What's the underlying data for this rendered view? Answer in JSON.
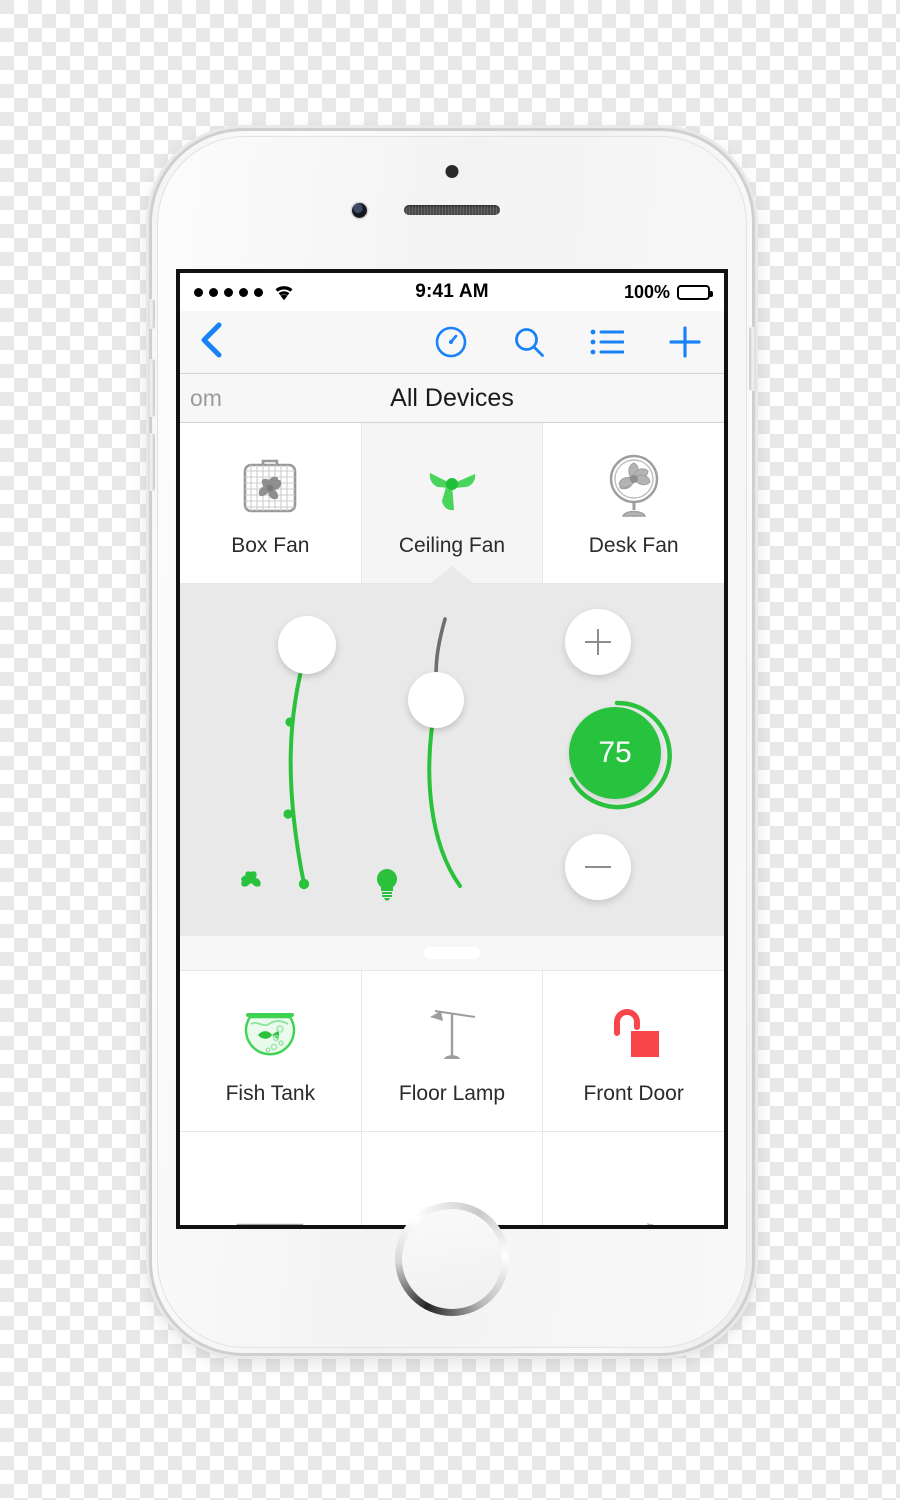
{
  "device": {
    "type": "smartphone",
    "color": "silver-white"
  },
  "statusbar": {
    "signal_dots": 5,
    "wifi_icon": "wifi-icon",
    "time": "9:41 AM",
    "battery_percent": "100%",
    "battery_level": 100
  },
  "navbar": {
    "back_icon": "chevron-left-icon",
    "accent_color": "#1a82f7",
    "icons": [
      {
        "name": "dashboard-gauge-icon",
        "label": "Dashboard"
      },
      {
        "name": "search-icon",
        "label": "Search"
      },
      {
        "name": "list-icon",
        "label": "List"
      },
      {
        "name": "plus-icon",
        "label": "Add"
      }
    ]
  },
  "titlebar": {
    "breadcrumb": "om",
    "title": "All Devices"
  },
  "grid": {
    "rows": [
      {
        "tiles": [
          {
            "label": "Box Fan",
            "icon": "box-fan-icon",
            "state": "off",
            "selected": false
          },
          {
            "label": "Ceiling Fan",
            "icon": "ceiling-fan-icon",
            "state": "on",
            "selected": true
          },
          {
            "label": "Desk Fan",
            "icon": "desk-fan-icon",
            "state": "off",
            "selected": false
          }
        ]
      },
      {
        "tiles": [
          {
            "label": "Fish Tank",
            "icon": "fish-tank-icon",
            "state": "on",
            "selected": false
          },
          {
            "label": "Floor Lamp",
            "icon": "floor-lamp-icon",
            "state": "off",
            "selected": false
          },
          {
            "label": "Front Door",
            "icon": "unlocked-padlock-icon",
            "state": "unlocked",
            "selected": false
          }
        ]
      },
      {
        "tiles": [
          {
            "label": "",
            "icon": "radiator-icon",
            "state": "off",
            "selected": false
          },
          {
            "label": "",
            "icon": "lava-lamp-icon",
            "state": "on",
            "selected": false
          },
          {
            "label": "",
            "icon": "desk-lamp-icon",
            "state": "off",
            "selected": false
          }
        ]
      }
    ]
  },
  "control_panel": {
    "drag_handle": "panel-drag-handle",
    "fan_pull": {
      "icon": "fan-blade-icon",
      "label": "Fan",
      "knob": "fan-chain-knob",
      "chain_color": "#2ac23d",
      "stops": 2
    },
    "light_pull": {
      "icon": "lightbulb-icon",
      "label": "Light",
      "knob": "light-chain-knob",
      "chain_color": "#2ac23d",
      "inactive_color": "#6e6e6e"
    },
    "stepper": {
      "increase_icon": "plus-icon",
      "decrease_icon": "minus-icon",
      "value": "75",
      "value_number": 75,
      "min": 0,
      "max": 100,
      "dial_color": "#27c33f",
      "arc_percent": 75
    }
  }
}
